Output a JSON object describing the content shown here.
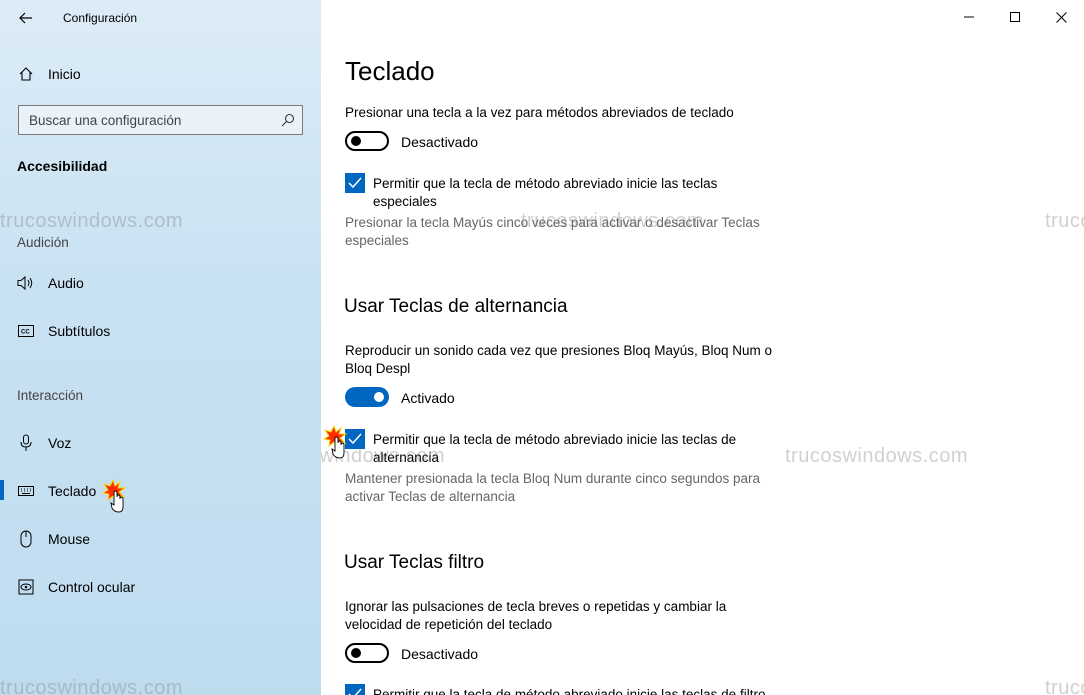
{
  "window": {
    "title": "Configuración",
    "controls": [
      "minimize-icon",
      "maximize-icon",
      "close-icon"
    ]
  },
  "sidebar": {
    "home_label": "Inicio",
    "search_placeholder": "Buscar una configuración",
    "category_title": "Accesibilidad",
    "section_audicion": "Audición",
    "section_interaccion": "Interacción",
    "items": [
      {
        "label": "Audio",
        "icon": "speaker-icon"
      },
      {
        "label": "Subtítulos",
        "icon": "closed-caption-icon"
      },
      {
        "label": "Voz",
        "icon": "microphone-icon"
      },
      {
        "label": "Teclado",
        "icon": "keyboard-icon",
        "selected": true
      },
      {
        "label": "Mouse",
        "icon": "mouse-icon"
      },
      {
        "label": "Control ocular",
        "icon": "eye-control-icon"
      }
    ]
  },
  "main": {
    "title": "Teclado",
    "sticky": {
      "description": "Presionar una tecla a la vez para métodos abreviados de teclado",
      "toggle_label": "Desactivado",
      "toggle_on": false,
      "checkbox_label": "Permitir que la tecla de método abreviado inicie las teclas especiales",
      "checkbox_checked": true,
      "hint": "Presionar la tecla Mayús cinco veces para activar o desactivar Teclas especiales"
    },
    "toggle_keys": {
      "heading": "Usar Teclas de alternancia",
      "description": "Reproducir un sonido cada vez que presiones Bloq Mayús, Bloq Num o Bloq Despl",
      "toggle_label": "Activado",
      "toggle_on": true,
      "checkbox_label": "Permitir que la tecla de método abreviado inicie las teclas de alternancia",
      "checkbox_checked": true,
      "hint": "Mantener presionada la tecla Bloq Num durante cinco segundos para activar Teclas de alternancia"
    },
    "filter_keys": {
      "heading": "Usar Teclas filtro",
      "description": "Ignorar las pulsaciones de tecla breves o repetidas y cambiar la velocidad de repetición del teclado",
      "toggle_label": "Desactivado",
      "toggle_on": false,
      "checkbox_label": "Permitir que la tecla de método abreviado inicie las teclas de filtro",
      "checkbox_checked": true
    }
  },
  "watermark": "trucoswindows.com",
  "colors": {
    "accent": "#0067c0",
    "sidebar_bg": "#c9e2f2"
  }
}
